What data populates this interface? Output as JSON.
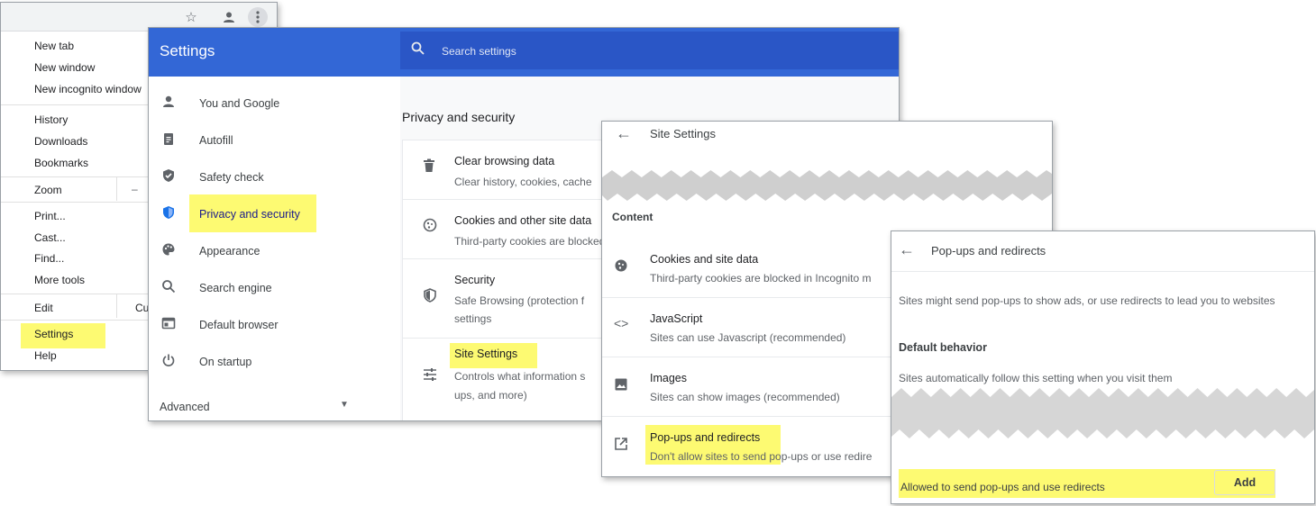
{
  "chrome_menu": {
    "items": [
      "New tab",
      "New window",
      "New incognito window",
      "History",
      "Downloads",
      "Bookmarks",
      "Zoom",
      "Print...",
      "Cast...",
      "Find...",
      "More tools",
      "Edit",
      "Settings",
      "Help"
    ],
    "zoom_minus": "–",
    "edit_cut": "Cu"
  },
  "settings": {
    "title": "Settings",
    "search_placeholder": "Search settings",
    "sidebar": [
      {
        "label": "You and Google",
        "icon": "person-icon"
      },
      {
        "label": "Autofill",
        "icon": "clipboard-icon"
      },
      {
        "label": "Safety check",
        "icon": "shield-check-icon"
      },
      {
        "label": "Privacy and security",
        "icon": "shield-icon"
      },
      {
        "label": "Appearance",
        "icon": "palette-icon"
      },
      {
        "label": "Search engine",
        "icon": "search-icon"
      },
      {
        "label": "Default browser",
        "icon": "browser-icon"
      },
      {
        "label": "On startup",
        "icon": "power-icon"
      }
    ],
    "advanced": "Advanced",
    "section_title": "Privacy and security",
    "rows": [
      {
        "title": "Clear browsing data",
        "desc": "Clear history, cookies, cache"
      },
      {
        "title": "Cookies and other site data",
        "desc": "Third-party cookies are blocked"
      },
      {
        "title": "Security",
        "desc": "Safe Browsing (protection f",
        "desc2": "settings"
      },
      {
        "title": "Site Settings",
        "desc": "Controls what information s",
        "desc2": "ups, and more)"
      }
    ]
  },
  "site_settings": {
    "title": "Site Settings",
    "content_label": "Content",
    "rows": [
      {
        "title": "Cookies and site data",
        "desc": "Third-party cookies are blocked in Incognito m"
      },
      {
        "title": "JavaScript",
        "desc": "Sites can use Javascript (recommended)"
      },
      {
        "title": "Images",
        "desc": "Sites can show images (recommended)"
      },
      {
        "title": "Pop-ups and redirects",
        "desc": "Don't allow sites to send pop-ups or use redire"
      }
    ]
  },
  "popups": {
    "title": "Pop-ups and redirects",
    "desc": "Sites might send pop-ups to show ads, or use redirects to lead you to websites",
    "default_behavior": "Default behavior",
    "default_desc": "Sites automatically follow this setting when you visit them",
    "allowed_label": "Allowed to send pop-ups and use redirects",
    "add_button": "Add"
  },
  "colors": {
    "highlight": "#fdfa72",
    "settings_header": "#3367d6",
    "search_bar": "#2a56c6"
  }
}
